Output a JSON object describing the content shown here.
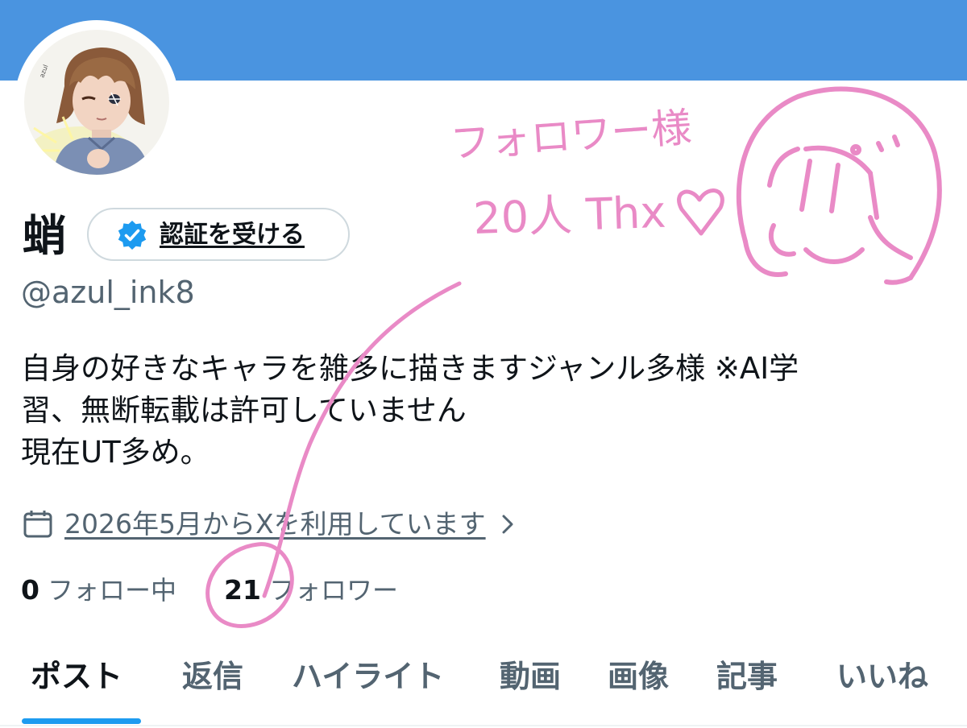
{
  "header": {
    "banner_color": "#4a94e0"
  },
  "profile": {
    "display_name": "蛸",
    "verify_button_label": "認証を受ける",
    "handle": "@azul_ink8",
    "bio_lines": [
      "自身の好きなキャラを雑多に描きますジャンル多様 ※AI学",
      "習、無断転載は許可していません",
      "現在UT多め。"
    ],
    "joined_text": "2026年5月からXを利用しています",
    "following_count": "0",
    "following_label": "フォロー中",
    "followers_count": "21",
    "followers_label": "フォロワー"
  },
  "tabs": [
    {
      "label": "ポスト",
      "active": true
    },
    {
      "label": "返信",
      "active": false
    },
    {
      "label": "ハイライト",
      "active": false
    },
    {
      "label": "動画",
      "active": false
    },
    {
      "label": "画像",
      "active": false
    },
    {
      "label": "記事",
      "active": false
    },
    {
      "label": "いいね",
      "active": false
    }
  ],
  "annotation": {
    "line1": "フォロワー様",
    "line2": "20人 Thx",
    "color": "#e98ac6"
  },
  "colors": {
    "accent": "#1d9bf0",
    "secondary_text": "#536471",
    "primary_text": "#0f1419"
  },
  "icons": [
    "verified-badge-icon",
    "calendar-icon",
    "chevron-right-icon",
    "heart-icon"
  ]
}
